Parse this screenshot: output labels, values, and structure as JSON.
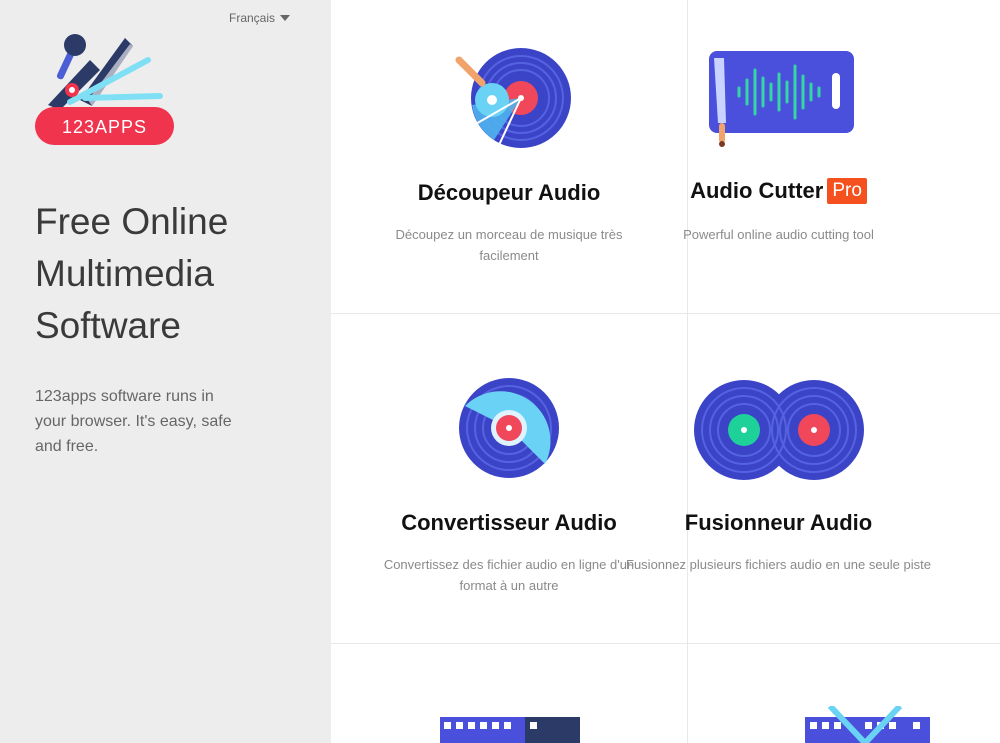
{
  "language": {
    "selected": "Français"
  },
  "brand": {
    "logo_text": "123APPS"
  },
  "sidebar": {
    "headline_lines": [
      "Free Online",
      "Multimedia",
      "Software"
    ],
    "tagline": "123apps software runs in your browser. It's easy, safe and free."
  },
  "apps": [
    {
      "title": "Découpeur Audio",
      "desc": "Découpez un morceau de musique très facilement",
      "icon": "vinyl-cut-icon"
    },
    {
      "title": "Audio Cutter",
      "badge": "Pro",
      "desc": "Powerful online audio cutting tool",
      "icon": "waveform-knife-icon"
    },
    {
      "title": "Convertisseur Audio",
      "desc": "Convertissez des fichier audio en ligne d'un format à un autre",
      "icon": "vinyl-convert-icon"
    },
    {
      "title": "Fusionneur Audio",
      "desc": "Fusionnez plusieurs fichiers audio en une seule piste",
      "icon": "vinyl-merge-icon"
    }
  ],
  "colors": {
    "sidebar_bg": "#eeedee",
    "vinyl_blue": "#3b44c7",
    "record_red": "#f0475b",
    "pro_badge": "#f4511e",
    "logo_red": "#f0344e"
  }
}
